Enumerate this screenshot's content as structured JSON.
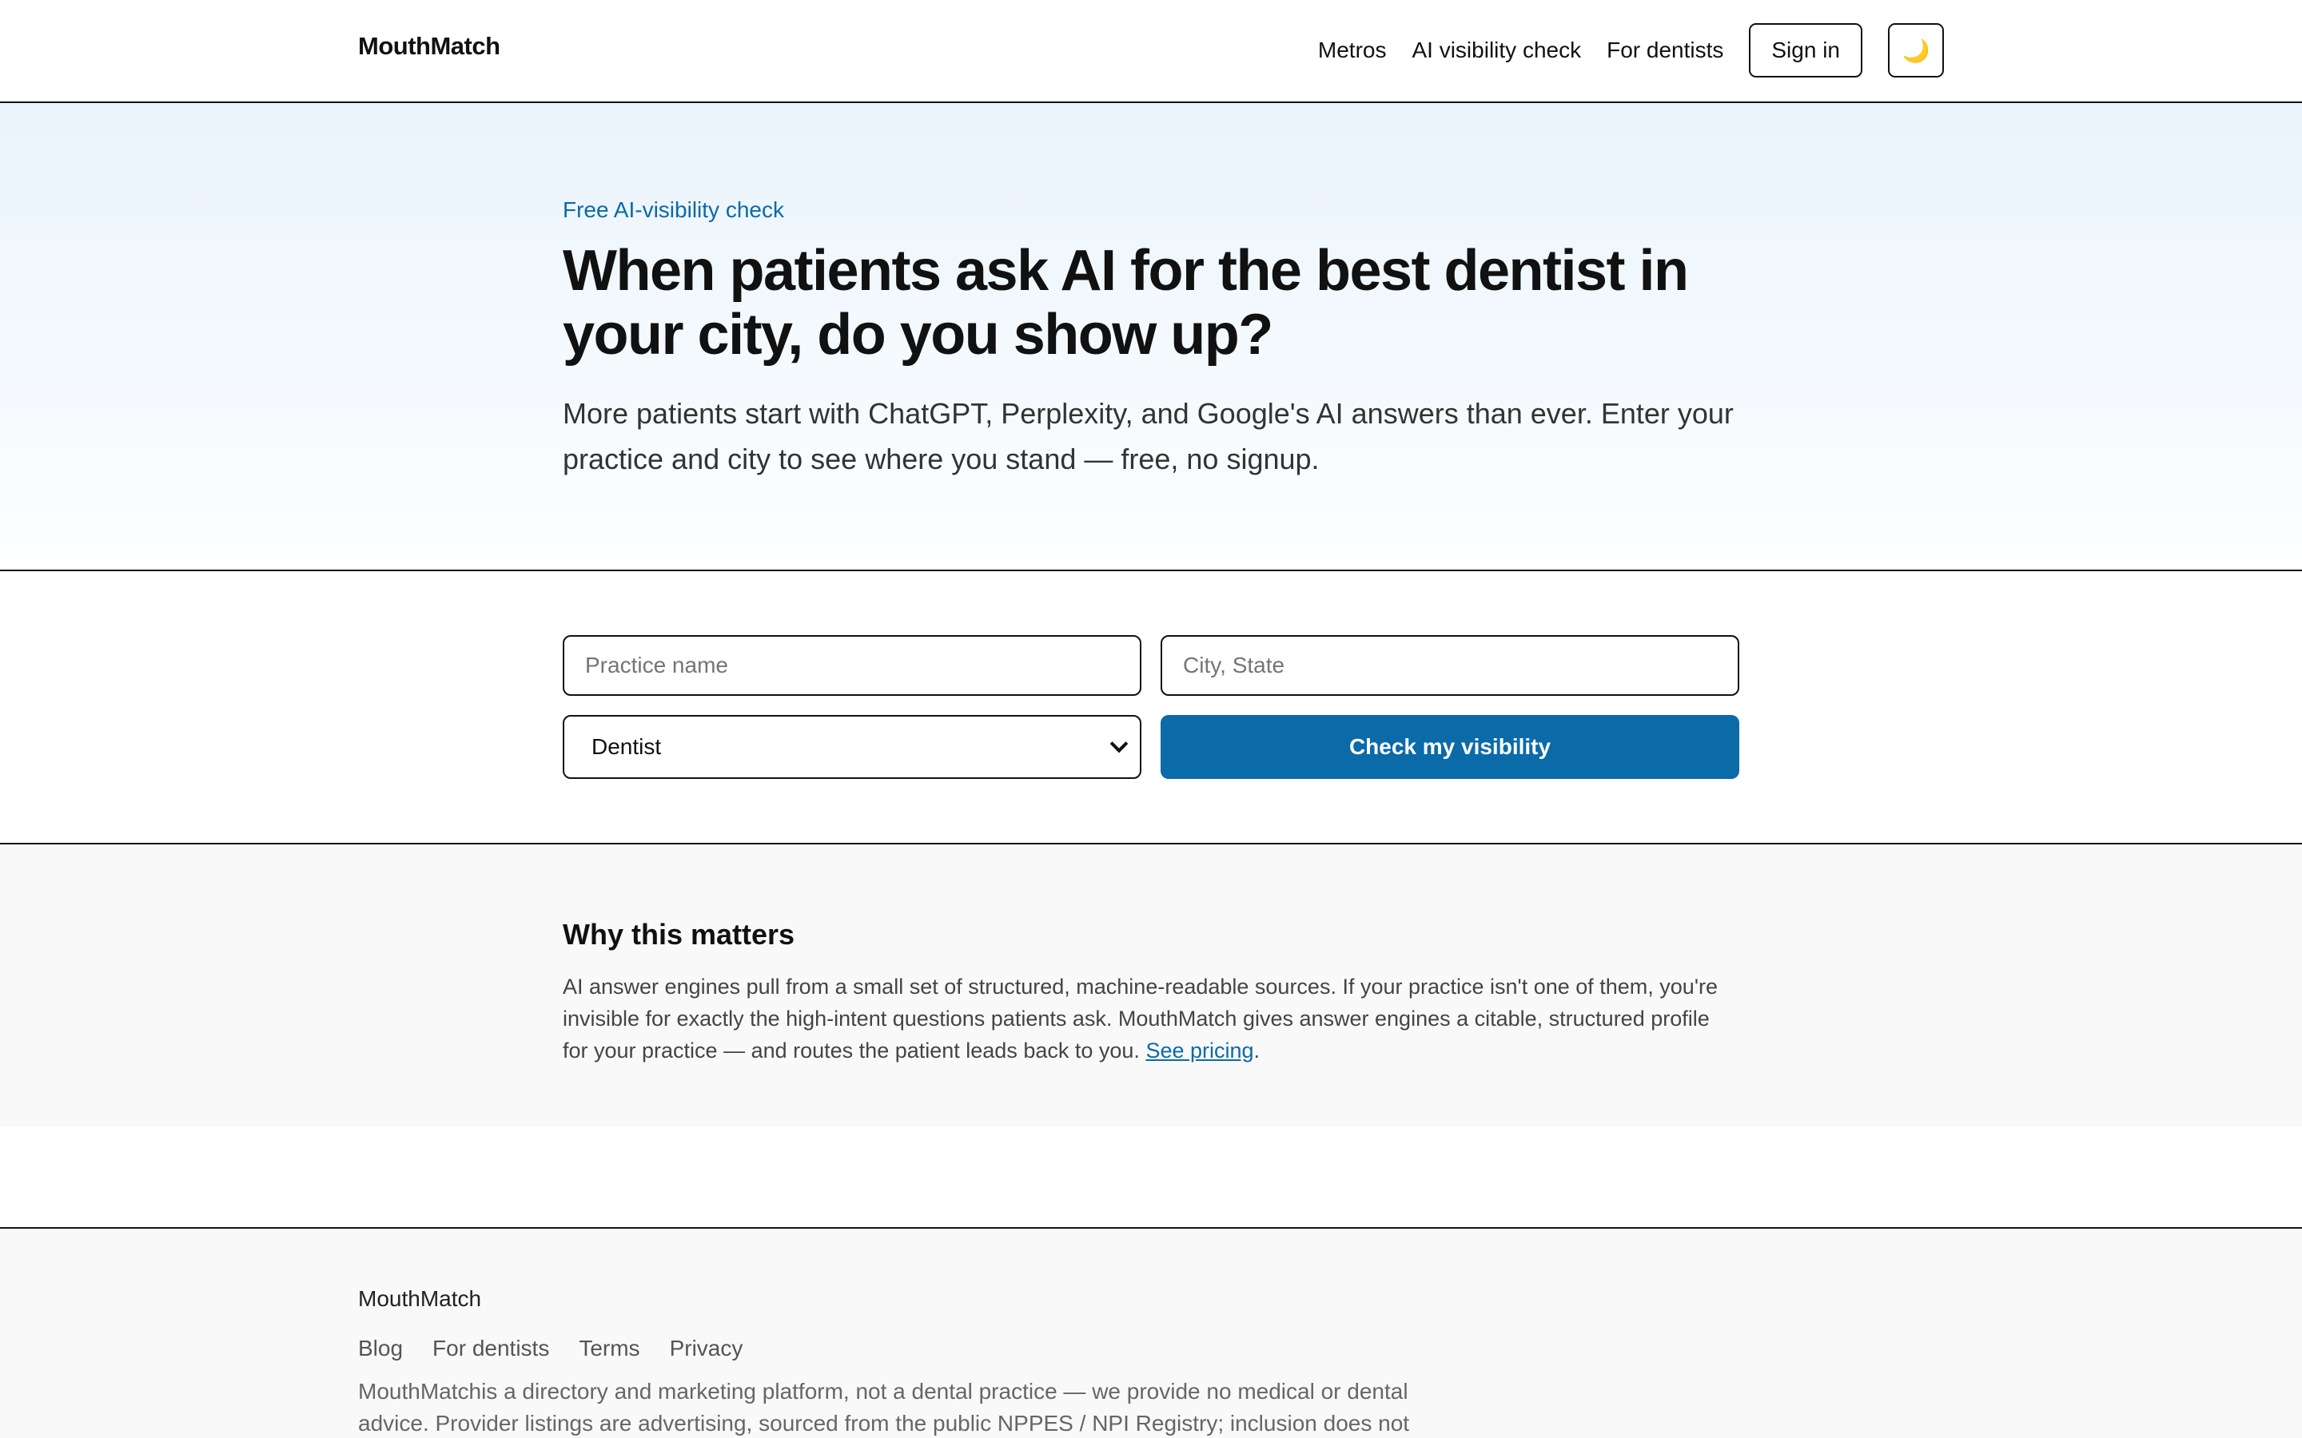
{
  "header": {
    "brand": "MouthMatch",
    "nav": [
      "Metros",
      "AI visibility check",
      "For dentists"
    ],
    "sign_in": "Sign in",
    "theme_toggle": "🌙"
  },
  "hero": {
    "eyebrow": "Free AI-visibility check",
    "title": "When patients ask AI for the best dentist in your city, do you show up?",
    "lead": "More patients start with ChatGPT, Perplexity, and Google's AI answers than ever. Enter your practice and city to see where you stand — free, no signup."
  },
  "form": {
    "practice_placeholder": "Practice name",
    "city_placeholder": "City, State",
    "specialty_selected": "Dentist",
    "submit": "Check my visibility"
  },
  "why": {
    "heading": "Why this matters",
    "body": "AI answer engines pull from a small set of structured, machine-readable sources. If your practice isn't one of them, you're invisible for exactly the high-intent questions patients ask. MouthMatch gives answer engines a citable, structured profile for your practice — and routes the patient leads back to you.",
    "link": "See pricing",
    "after_link": "."
  },
  "footer": {
    "brand": "MouthMatch",
    "links": [
      "Blog",
      "For dentists",
      "Terms",
      "Privacy"
    ],
    "disclaimer": "MouthMatchis a directory and marketing platform, not a dental practice — we provide no medical or dental advice. Provider listings are advertising, sourced from the public NPPES / NPI Registry; inclusion does not"
  },
  "colors": {
    "accent": "#0b6aa8",
    "border": "#111111",
    "band_gray": "#f9f9f9"
  }
}
